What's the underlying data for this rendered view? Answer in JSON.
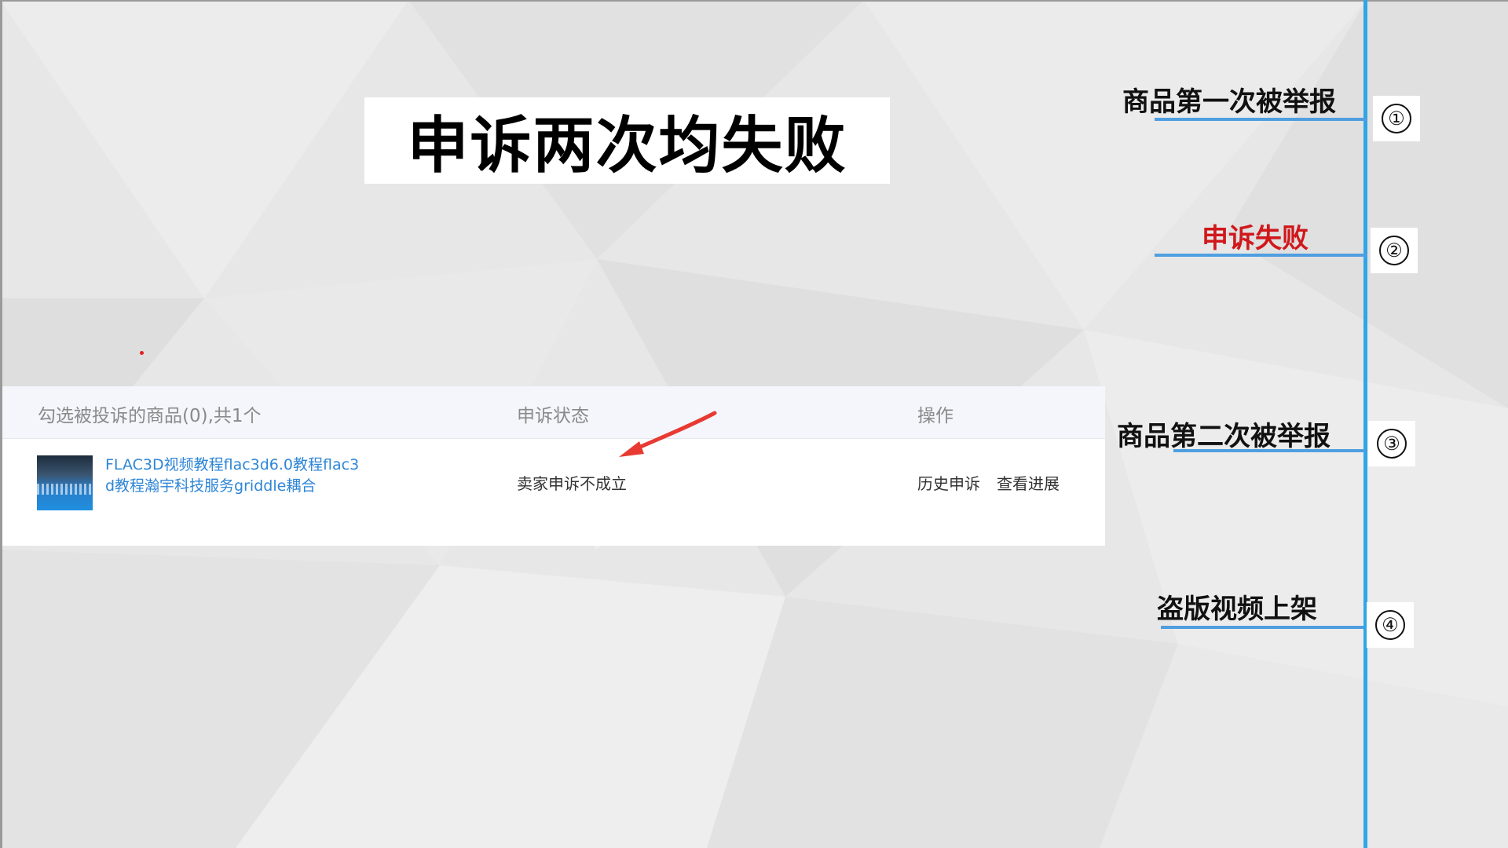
{
  "title": "申诉两次均失败",
  "table": {
    "headers": {
      "product": "勾选被投诉的商品(0),共1个",
      "status": "申诉状态",
      "actions": "操作"
    },
    "row": {
      "name_line1": "FLAC3D视频教程flac3d6.0教程flac3",
      "name_line2": "d教程瀚宇科技服务griddle耦合",
      "status": "卖家申诉不成立",
      "action_history": "历史申诉",
      "action_progress": "查看进展"
    }
  },
  "timeline": {
    "line_color": "#2ea6e8",
    "accent_red": "#d0181c",
    "steps": [
      {
        "number": "①",
        "label": "商品第一次被举报"
      },
      {
        "number": "②",
        "label": "申诉失败"
      },
      {
        "number": "③",
        "label": "商品第二次被举报"
      },
      {
        "number": "④",
        "label": "盗版视频上架"
      }
    ]
  }
}
